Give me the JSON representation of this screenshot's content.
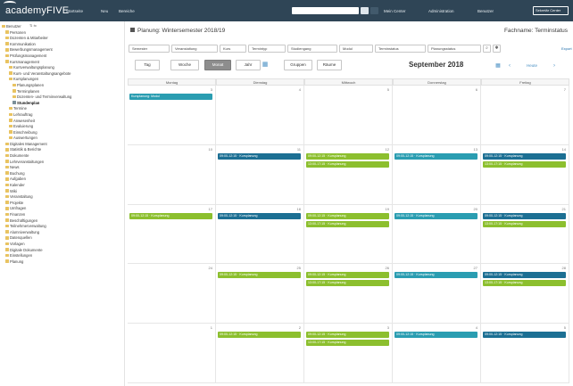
{
  "topbar": {
    "logo": "academyFIVE",
    "nav": [
      "Startseite",
      "Neu",
      "Bereiche"
    ],
    "search_placeholder": "Schnellsuche",
    "links": [
      "Mein Center",
      "Administration",
      "Benutzer"
    ],
    "user": "Sekretär Center"
  },
  "sidebar": {
    "items": [
      {
        "label": "Benutzer"
      },
      {
        "label": "Personen"
      },
      {
        "label": "Dozenten & Mitarbeiter"
      },
      {
        "label": "Kommunikation"
      },
      {
        "label": "Bewerbungsmanagement"
      },
      {
        "label": "Prüfungsmanagement"
      },
      {
        "label": "Kursmanagement"
      },
      {
        "label": "Kursverwaltungsplanung"
      },
      {
        "label": "Kurs- und Veranstaltungsangebote"
      },
      {
        "label": "Kursplanungen"
      },
      {
        "label": "Planungsplanen"
      },
      {
        "label": "Terminplanen"
      },
      {
        "label": "Dozenten- und Terminverwaltung"
      },
      {
        "label": "Stundenplan",
        "selected": true
      },
      {
        "label": "Termine"
      },
      {
        "label": "Lehrauftrag"
      },
      {
        "label": "Anwesenheit"
      },
      {
        "label": "Evaluierung"
      },
      {
        "label": "Einschreibung"
      },
      {
        "label": "Auswertungen"
      },
      {
        "label": "Digitales Management"
      },
      {
        "label": "Statistik & Berichte"
      },
      {
        "label": "Dokumente"
      },
      {
        "label": "Lehrveranstaltungen"
      },
      {
        "label": "News"
      },
      {
        "label": "Buchung"
      },
      {
        "label": "Aufgaben"
      },
      {
        "label": "Kalender"
      },
      {
        "label": "Wiki"
      },
      {
        "label": "Veranstaltung"
      },
      {
        "label": "Projekte"
      },
      {
        "label": "Umfragen"
      },
      {
        "label": "Finanzen"
      },
      {
        "label": "Beschäftigungen"
      },
      {
        "label": "Teilnehmerverwaltung"
      },
      {
        "label": "Alumniverwaltung"
      },
      {
        "label": "Datenquellen"
      },
      {
        "label": "Vorlagen"
      },
      {
        "label": "Digitale Dokumente"
      },
      {
        "label": "Einstellungen"
      },
      {
        "label": "Planung"
      }
    ]
  },
  "main": {
    "plan_title": "Planung: Wintersemester 2018/19",
    "fachname": "Fachname: Terminstatus",
    "filters": [
      "Semester",
      "Veranstaltung",
      "Kurs",
      "Termintyp",
      "Studiengang",
      "Modul",
      "Terminstatus",
      "Planungsstatus"
    ],
    "export_label": "Export",
    "views": [
      "Tag",
      "Woche",
      "Monat",
      "Jahr",
      "Gruppen",
      "Räume"
    ],
    "active_view": "Monat",
    "month_label": "September 2018",
    "today_label": "Heute",
    "weekdays": [
      "Montag",
      "Dienstag",
      "Mittwoch",
      "Donnerstag",
      "Freitag"
    ],
    "weeks": [
      {
        "days": [
          {
            "num": "3",
            "events": [
              {
                "text": "Kursplanung: Modul",
                "color": "teal"
              }
            ]
          },
          {
            "num": "4",
            "events": []
          },
          {
            "num": "5",
            "events": []
          },
          {
            "num": "6",
            "events": []
          },
          {
            "num": "7",
            "events": []
          }
        ]
      },
      {
        "days": [
          {
            "num": "10",
            "events": []
          },
          {
            "num": "11",
            "events": [
              {
                "text": "09:00-12:15 · Kursplanung",
                "color": "blue"
              }
            ]
          },
          {
            "num": "12",
            "events": [
              {
                "text": "09:00-12:15 · Kursplanung",
                "color": "green"
              },
              {
                "text": "13:00-17:15 · Kursplanung",
                "color": "green"
              }
            ]
          },
          {
            "num": "13",
            "events": [
              {
                "text": "09:00-12:15 · Kursplanung",
                "color": "teal"
              }
            ]
          },
          {
            "num": "14",
            "events": [
              {
                "text": "09:00-12:15 · Kursplanung",
                "color": "blue"
              },
              {
                "text": "13:00-17:15 · Kursplanung",
                "color": "green"
              }
            ]
          }
        ]
      },
      {
        "days": [
          {
            "num": "17",
            "events": [
              {
                "text": "09:00-12:15 · Kursplanung",
                "color": "green"
              }
            ]
          },
          {
            "num": "18",
            "events": [
              {
                "text": "09:00-12:15 · Kursplanung",
                "color": "blue"
              }
            ]
          },
          {
            "num": "19",
            "events": [
              {
                "text": "09:00-12:15 · Kursplanung",
                "color": "green"
              },
              {
                "text": "13:00-17:15 · Kursplanung",
                "color": "green"
              }
            ]
          },
          {
            "num": "20",
            "events": [
              {
                "text": "09:00-12:15 · Kursplanung",
                "color": "teal"
              }
            ]
          },
          {
            "num": "21",
            "events": [
              {
                "text": "09:00-12:15 · Kursplanung",
                "color": "blue"
              },
              {
                "text": "13:00-17:15 · Kursplanung",
                "color": "green"
              }
            ]
          }
        ]
      },
      {
        "days": [
          {
            "num": "24",
            "events": []
          },
          {
            "num": "25",
            "events": [
              {
                "text": "09:00-12:15 · Kursplanung",
                "color": "green"
              }
            ]
          },
          {
            "num": "26",
            "events": [
              {
                "text": "09:00-12:15 · Kursplanung",
                "color": "green"
              },
              {
                "text": "13:00-17:15 · Kursplanung",
                "color": "green"
              }
            ]
          },
          {
            "num": "27",
            "events": [
              {
                "text": "09:00-12:15 · Kursplanung",
                "color": "teal"
              }
            ]
          },
          {
            "num": "28",
            "events": [
              {
                "text": "09:00-12:15 · Kursplanung",
                "color": "blue"
              },
              {
                "text": "13:00-17:15 · Kursplanung",
                "color": "green"
              }
            ]
          }
        ]
      },
      {
        "days": [
          {
            "num": "1",
            "events": []
          },
          {
            "num": "2",
            "events": [
              {
                "text": "09:00-12:15 · Kursplanung",
                "color": "green"
              }
            ]
          },
          {
            "num": "3",
            "events": [
              {
                "text": "09:00-12:15 · Kursplanung",
                "color": "green"
              },
              {
                "text": "13:00-17:15 · Kursplanung",
                "color": "green"
              }
            ]
          },
          {
            "num": "4",
            "events": [
              {
                "text": "09:00-12:15 · Kursplanung",
                "color": "teal"
              }
            ]
          },
          {
            "num": "5",
            "events": [
              {
                "text": "09:00-12:15 · Kursplanung",
                "color": "blue"
              }
            ]
          }
        ]
      }
    ]
  },
  "colors": {
    "topbar": "#2f4556",
    "teal": "#2a9db1",
    "blue": "#1c6f93",
    "green": "#8cbf2e"
  }
}
